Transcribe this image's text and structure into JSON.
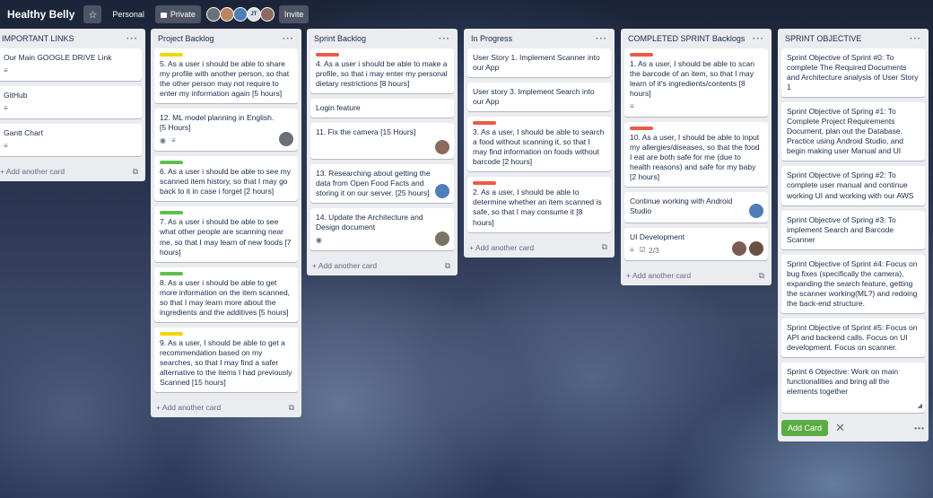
{
  "header": {
    "board_name": "Healthy Belly",
    "star_icon": "☆",
    "team_label": "Personal",
    "visibility_label": "Private",
    "invite_label": "Invite",
    "avatar_initials": "JT"
  },
  "colors": {
    "green": "#61bd4f",
    "yellow": "#f2d600",
    "red": "#eb5a46"
  },
  "lists": [
    {
      "title": "IMPORTANT LINKS",
      "cards": [
        {
          "text": "Our Main GOOGLE DRIVE Link",
          "desc_icon": "≡"
        },
        {
          "text": "GitHub",
          "desc_icon": "≡"
        },
        {
          "text": "Gantt Chart",
          "desc_icon": "≡"
        }
      ],
      "add_label": "Add another card"
    },
    {
      "title": "Project Backlog",
      "cards": [
        {
          "label": "yellow",
          "text": "5. As a user i should be able to share my profile with another person, so that the other person may not require to enter my information again [5 hours]"
        },
        {
          "text": "12. ML model planning in English. [5 Hours]",
          "watch_icon": "◉",
          "desc_icon": "≡"
        },
        {
          "label": "green",
          "text": "6. As a user i should be able to see my scanned item history, so that I may go back to it in case i forget [2 hours]"
        },
        {
          "label": "green",
          "text": "7. As a user i should be able to see what other people are scanning near me, so that I may learn of new foods [7 hours]"
        },
        {
          "label": "green",
          "text": "8. As a user i should be able to get more information on the item scanned, so that I may learn more about the ingredients and the additives [5 hours]"
        },
        {
          "label": "yellow",
          "text": "9. As a user, I should be able to get a recommendation based on my searches, so that I may find a safer alternative to the items I had previously Scanned [15 hours]"
        }
      ],
      "add_label": "Add another card"
    },
    {
      "title": "Sprint Backlog",
      "cards": [
        {
          "label": "red",
          "text": "4. As a user i should be able to make a profile, so that i may enter my personal dietary restrictions [8 hours]"
        },
        {
          "text": "Login feature"
        },
        {
          "text": "11. Fix the camera [15 Hours]"
        },
        {
          "text": "13. Researching about getting the data from Open Food Facts and storing it on our server. [25 hours]"
        },
        {
          "text": "14. Update the Architecture and Design document",
          "watch_icon": "◉"
        }
      ],
      "add_label": "Add another card"
    },
    {
      "title": "In Progress",
      "cards": [
        {
          "text": "User Story 1. Implement Scanner into our App"
        },
        {
          "text": "User story 3. Implement Search into our App"
        },
        {
          "label": "red",
          "text": "3. As a user, I should be able to search a food without scanning it, so that I may find information on foods without barcode [2 hours]"
        },
        {
          "label": "red",
          "text": "2. As a user, I should be able to determine whether an item scanned is safe, so that I may consume it [8 hours]"
        }
      ],
      "add_label": "Add another card"
    },
    {
      "title": "COMPLETED SPRINT Backlogs",
      "cards": [
        {
          "label": "red",
          "text": "1. As a user, I should be able to scan the barcode of an item, so that I may learn of it's ingredients/contents [8 hours]",
          "desc_icon": "≡"
        },
        {
          "label": "red",
          "text": "10. As a user, I should be able to input my allergies/diseases, so that the food I eat are both safe for me (due to health reasons) and safe for my baby [2 hours]"
        },
        {
          "text": "Continue working with Android Studio"
        },
        {
          "text": "UI Development",
          "desc_icon": "≡",
          "checklist_icon": "☑",
          "checklist": "2/3"
        }
      ],
      "add_label": "Add another card"
    },
    {
      "title": "SPRINT OBJECTIVE",
      "cards": [
        {
          "text": "Sprint Objective of Sprint #0: To complete The Required Documents and Architecture analysis of User Story 1"
        },
        {
          "text": "Sprint Objective of Spring #1: To Complete Project Requirements Document, plan out the Database, Practice using Android Studio, and begin making user Manual and UI"
        },
        {
          "text": "Sprint Objective of Spring #2: To complete user manual and continue working UI and working with our AWS"
        },
        {
          "text": "Sprint Objective of Spring #3: To implement Search and Barcode Scanner"
        },
        {
          "text": "Sprint Objective of Sprint #4: Focus on bug fixes (specifically the camera), expanding the search feature, getting the scanner working(ML?) and redoing the back-end structure."
        },
        {
          "text": "Sprint Objective of Sprint #5: Focus on API and backend calls. Focus on UI development. Focus on scanner."
        }
      ],
      "composer_text": "Sprint 6 Objective: Work on main functionalities and bring all the elements together",
      "add_button": "Add Card",
      "close_icon": "✕",
      "more_icon": "•••"
    }
  ]
}
